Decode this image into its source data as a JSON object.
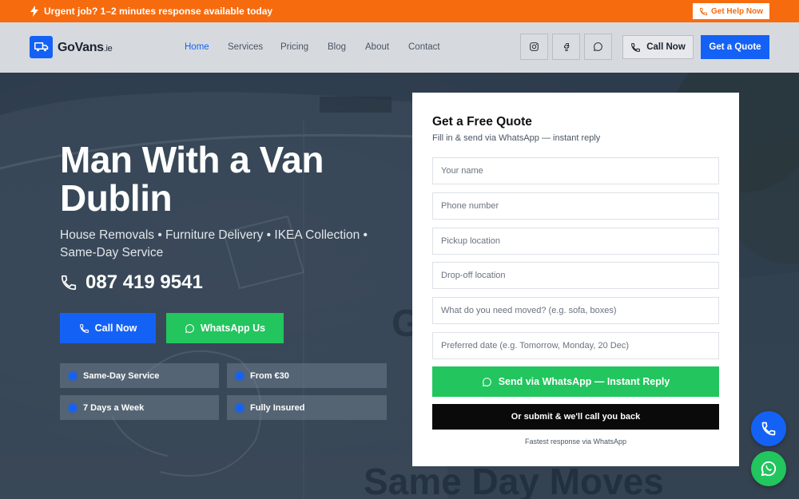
{
  "topbar": {
    "message": "Urgent job? 1–2 minutes response available today",
    "help_label": "Get Help Now"
  },
  "header": {
    "logo_name": "GoVans",
    "logo_tld": ".ie",
    "nav": [
      "Home",
      "Services",
      "Pricing",
      "Blog",
      "About",
      "Contact"
    ],
    "active_nav": "Home",
    "social": [
      "instagram-icon",
      "facebook-icon",
      "whatsapp-icon"
    ],
    "call_label": "Call Now",
    "quote_label": "Get a Quote"
  },
  "hero": {
    "title_line1": "Man With a Van",
    "title_line2": "Dublin",
    "subtitle": "House Removals • Furniture Delivery • IKEA Collection • Same-Day Service",
    "phone": "087 419 9541",
    "call_label": "Call Now",
    "whatsapp_label": "WhatsApp Us",
    "features": [
      "Same-Day Service",
      "From €30",
      "7 Days a Week",
      "Fully Insured"
    ]
  },
  "quote_form": {
    "title": "Get a Free Quote",
    "subtitle": "Fill in & send via WhatsApp — instant reply",
    "placeholders": {
      "name": "Your name",
      "phone": "Phone number",
      "pickup": "Pickup location",
      "dropoff": "Drop-off location",
      "items": "What do you need moved? (e.g. sofa, boxes)",
      "date": "Preferred date (e.g. Tomorrow, Monday, 20 Dec)"
    },
    "whatsapp_submit": "Send via WhatsApp — Instant Reply",
    "callback_submit": "Or submit & we'll call you back",
    "note": "Fastest response via WhatsApp"
  },
  "colors": {
    "accent_orange": "#f76b0f",
    "brand_blue": "#1462f5",
    "whatsapp_green": "#22c55e"
  }
}
